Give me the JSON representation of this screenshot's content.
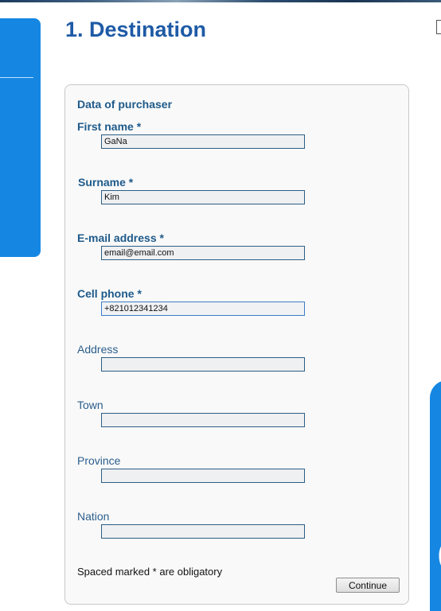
{
  "page": {
    "title": "1. Destination"
  },
  "form": {
    "section_title": "Data of purchaser",
    "fields": [
      {
        "label": "First name *",
        "value": "GaNa",
        "required": true
      },
      {
        "label": "Surname *",
        "value": "Kim",
        "required": true
      },
      {
        "label": "E-mail address *",
        "value": "email@email.com",
        "required": true
      },
      {
        "label": "Cell phone *",
        "value": "+821012341234",
        "required": true
      },
      {
        "label": "Address",
        "value": "",
        "required": false
      },
      {
        "label": "Town",
        "value": "",
        "required": false
      },
      {
        "label": "Province",
        "value": "",
        "required": false
      },
      {
        "label": "Nation",
        "value": "",
        "required": false
      }
    ],
    "footnote": "Spaced marked * are obligatory",
    "continue_label": "Continue"
  },
  "colors": {
    "accent_blue": "#1587e3",
    "title_blue": "#1e5aa6",
    "label_blue": "#1e5a8a"
  }
}
